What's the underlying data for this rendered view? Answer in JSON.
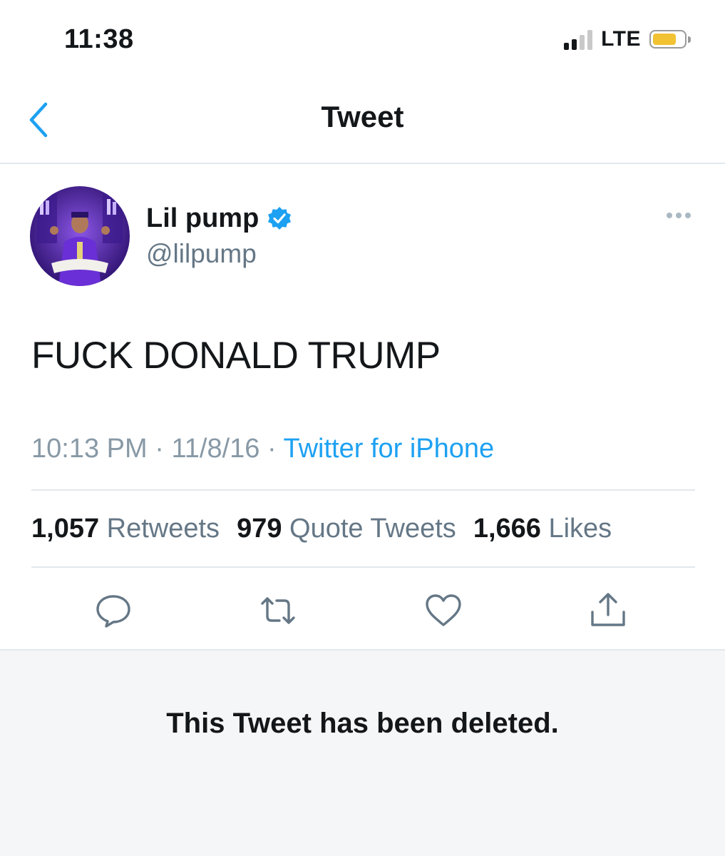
{
  "status_bar": {
    "time": "11:38",
    "network": "LTE",
    "battery_color": "#f1c232"
  },
  "header": {
    "title": "Tweet",
    "back_icon": "chevron-left-icon"
  },
  "tweet": {
    "display_name": "Lil pump",
    "verified": true,
    "handle": "@lilpump",
    "text": "FUCK DONALD TRUMP",
    "time": "10:13 PM",
    "date": "11/8/16",
    "separator": "·",
    "source": "Twitter for iPhone",
    "stats": [
      {
        "count": "1,057",
        "label": "Retweets"
      },
      {
        "count": "979",
        "label": "Quote Tweets"
      },
      {
        "count": "1,666",
        "label": "Likes"
      }
    ],
    "actions": [
      "reply-icon",
      "retweet-icon",
      "like-icon",
      "share-icon"
    ]
  },
  "deleted_notice": "This Tweet has been deleted.",
  "colors": {
    "accent": "#1da1f2",
    "secondary_text": "#657786",
    "divider": "#e1e8ed",
    "deleted_bg": "#f5f6f7"
  }
}
